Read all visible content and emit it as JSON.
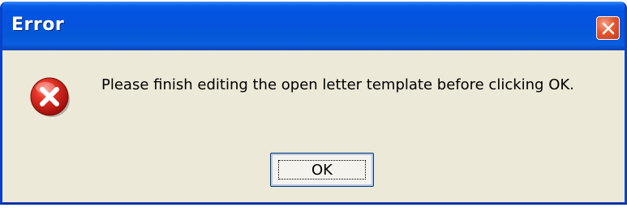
{
  "dialog": {
    "title": "Error",
    "message": "Please finish editing the open letter template before clicking OK.",
    "ok_label": "OK",
    "icons": {
      "close": "close-icon",
      "error": "error-icon"
    },
    "colors": {
      "titlebar": "#0553de",
      "body": "#ece9d8",
      "close_button": "#e5582f",
      "error_icon": "#d3201b"
    }
  }
}
